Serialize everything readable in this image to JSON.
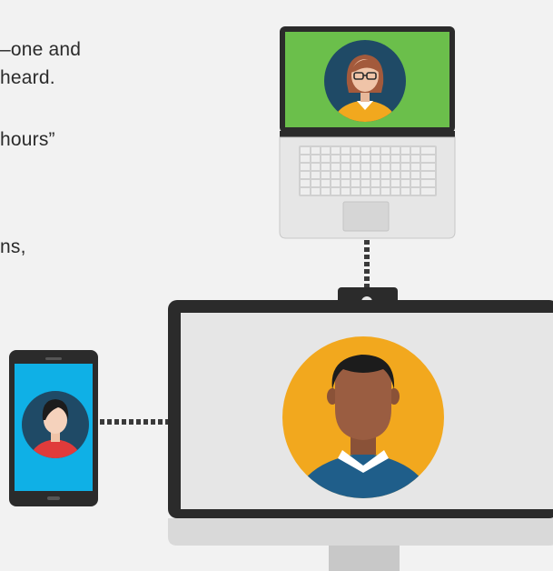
{
  "text_fragments": [
    "–one and",
    "heard.",
    "hours”",
    "ns,"
  ],
  "colors": {
    "background": "#f2f2f2",
    "laptop_screen": "#6bbf4b",
    "phone_screen": "#0fb0e6",
    "monitor_avatar_bg": "#f2a81e",
    "avatar_dark_bg": "#1f4a66",
    "device_dark": "#2b2b2b",
    "device_light": "#e6e6e6"
  },
  "devices": {
    "laptop": {
      "avatar": "woman-with-glasses-avatar"
    },
    "monitor": {
      "avatar": "man-avatar"
    },
    "phone": {
      "avatar": "woman-avatar"
    }
  }
}
